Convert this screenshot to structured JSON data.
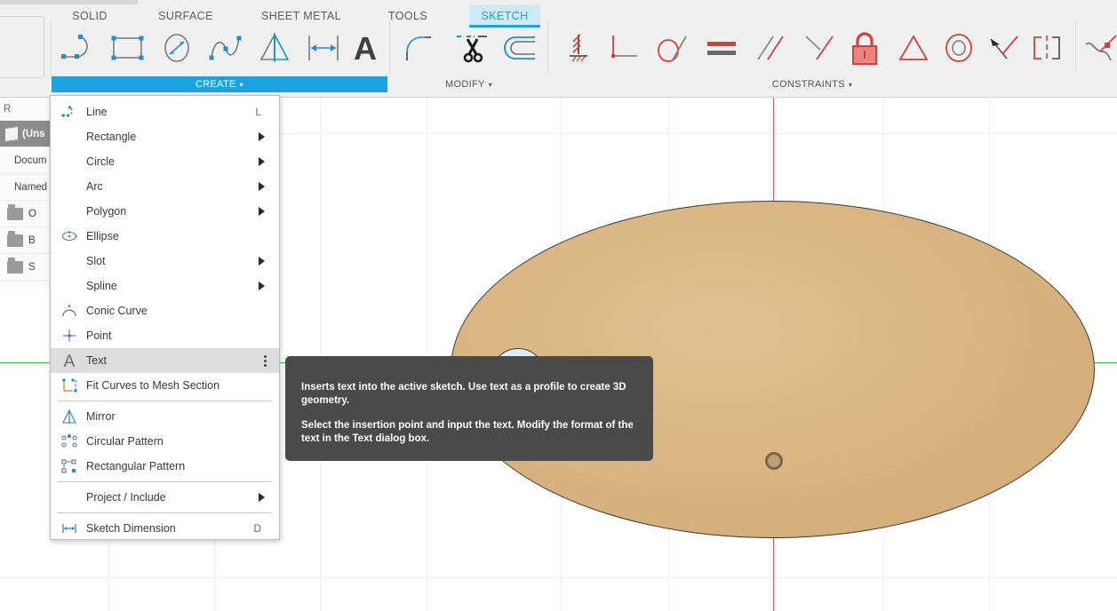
{
  "app": {
    "tabs": [
      {
        "label": "SOLID",
        "active": false
      },
      {
        "label": "SURFACE",
        "active": false
      },
      {
        "label": "SHEET METAL",
        "active": false
      },
      {
        "label": "TOOLS",
        "active": false
      },
      {
        "label": "SKETCH",
        "active": true
      }
    ],
    "accent_color": "#1aa3e0",
    "constraint_color": "#d2403a"
  },
  "panels": {
    "create": {
      "label": "CREATE",
      "caret": "▾"
    },
    "modify": {
      "label": "MODIFY",
      "caret": "▾"
    },
    "constraints": {
      "label": "CONSTRAINTS",
      "caret": "▾"
    }
  },
  "toolbar": {
    "create_tools": [
      {
        "name": "line-tool",
        "title": "Line"
      },
      {
        "name": "rectangle-tool",
        "title": "Rectangle"
      },
      {
        "name": "circle-tool",
        "title": "Circle"
      },
      {
        "name": "spline-tool",
        "title": "Spline"
      },
      {
        "name": "mirror-tool",
        "title": "Mirror"
      },
      {
        "name": "sketch-dimension-tool",
        "title": "Sketch Dimension"
      },
      {
        "name": "text-tool",
        "title": "Text"
      }
    ],
    "modify_tools": [
      {
        "name": "fillet-tool",
        "title": "Fillet"
      },
      {
        "name": "trim-tool",
        "title": "Trim"
      },
      {
        "name": "offset-tool",
        "title": "Offset"
      }
    ],
    "constraint_tools": [
      {
        "name": "fix-unfix-constraint",
        "title": "Fix/UnFix"
      },
      {
        "name": "perpendicular-constraint",
        "title": "Perpendicular"
      },
      {
        "name": "tangent-constraint",
        "title": "Tangent"
      },
      {
        "name": "equal-constraint",
        "title": "Equal"
      },
      {
        "name": "parallel-constraint",
        "title": "Parallel"
      },
      {
        "name": "coincident-constraint",
        "title": "Coincident"
      },
      {
        "name": "lock-constraint",
        "title": "Lock"
      },
      {
        "name": "symmetry-constraint",
        "title": "Symmetry"
      },
      {
        "name": "concentric-constraint",
        "title": "Concentric"
      },
      {
        "name": "midpoint-constraint",
        "title": "Midpoint"
      },
      {
        "name": "collinear-constraint",
        "title": "Collinear"
      },
      {
        "name": "curvature-constraint",
        "title": "Curvature"
      }
    ]
  },
  "browser": {
    "header": "R",
    "rows": [
      {
        "label": "(Uns",
        "type": "document",
        "selected": true
      },
      {
        "label": "Docum",
        "type": "text",
        "selected": false
      },
      {
        "label": "Named",
        "type": "text",
        "selected": false
      },
      {
        "label": "O",
        "type": "folder",
        "selected": false
      },
      {
        "label": "B",
        "type": "folder",
        "selected": false
      },
      {
        "label": "S",
        "type": "folder",
        "selected": false
      }
    ]
  },
  "create_menu": {
    "items": [
      {
        "label": "Line",
        "icon": "line-icon",
        "shortcut": "L",
        "submenu": false,
        "selected": false,
        "divider_after": false
      },
      {
        "label": "Rectangle",
        "icon": "",
        "shortcut": "",
        "submenu": true,
        "selected": false,
        "divider_after": false
      },
      {
        "label": "Circle",
        "icon": "",
        "shortcut": "",
        "submenu": true,
        "selected": false,
        "divider_after": false
      },
      {
        "label": "Arc",
        "icon": "",
        "shortcut": "",
        "submenu": true,
        "selected": false,
        "divider_after": false
      },
      {
        "label": "Polygon",
        "icon": "",
        "shortcut": "",
        "submenu": true,
        "selected": false,
        "divider_after": false
      },
      {
        "label": "Ellipse",
        "icon": "ellipse-icon",
        "shortcut": "",
        "submenu": false,
        "selected": false,
        "divider_after": false
      },
      {
        "label": "Slot",
        "icon": "",
        "shortcut": "",
        "submenu": true,
        "selected": false,
        "divider_after": false
      },
      {
        "label": "Spline",
        "icon": "",
        "shortcut": "",
        "submenu": true,
        "selected": false,
        "divider_after": false
      },
      {
        "label": "Conic Curve",
        "icon": "conic-curve-icon",
        "shortcut": "",
        "submenu": false,
        "selected": false,
        "divider_after": false
      },
      {
        "label": "Point",
        "icon": "point-icon",
        "shortcut": "",
        "submenu": false,
        "selected": false,
        "divider_after": false
      },
      {
        "label": "Text",
        "icon": "text-icon",
        "shortcut": "",
        "submenu": false,
        "selected": true,
        "overflow_dots": true,
        "divider_after": false
      },
      {
        "label": "Fit Curves to Mesh Section",
        "icon": "fit-curves-icon",
        "shortcut": "",
        "submenu": false,
        "selected": false,
        "divider_after": true
      },
      {
        "label": "Mirror",
        "icon": "mirror-icon",
        "shortcut": "",
        "submenu": false,
        "selected": false,
        "divider_after": false
      },
      {
        "label": "Circular Pattern",
        "icon": "circular-pattern-icon",
        "shortcut": "",
        "submenu": false,
        "selected": false,
        "divider_after": false
      },
      {
        "label": "Rectangular Pattern",
        "icon": "rectangular-pattern-icon",
        "shortcut": "",
        "submenu": false,
        "selected": false,
        "divider_after": true
      },
      {
        "label": "Project / Include",
        "icon": "",
        "shortcut": "",
        "submenu": true,
        "selected": false,
        "divider_after": true
      },
      {
        "label": "Sketch Dimension",
        "icon": "sketch-dimension-icon",
        "shortcut": "D",
        "submenu": false,
        "selected": false,
        "divider_after": false
      }
    ]
  },
  "tooltip": {
    "paragraph1": "Inserts text into the active sketch. Use text as a profile to create 3D geometry.",
    "paragraph2": "Select the insertion point and input the text. Modify the format of the text in the Text dialog box."
  },
  "canvas": {
    "origin_label": "origin-point",
    "body_color": "#d9b684",
    "hole_color": "#dfecf7",
    "x_axis_color": "#2fc13c",
    "y_axis_color": "#e05a4e",
    "grid_color": "#f1f1f1"
  }
}
